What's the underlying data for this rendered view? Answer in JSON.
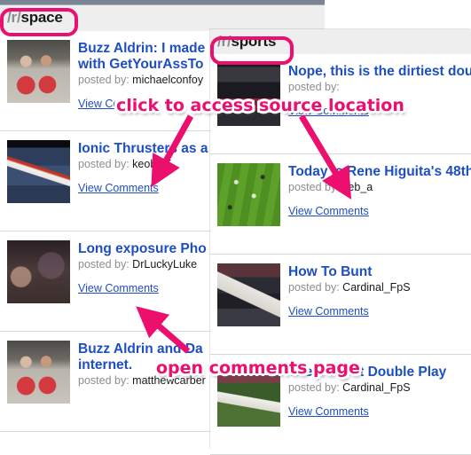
{
  "page": {
    "accent_highlight": "#ec0f6e",
    "link_color": "#1d4ec4",
    "header_bg": "#eeeeee"
  },
  "panels": [
    {
      "id": "space",
      "subreddit_prefix": "/r/",
      "subreddit_name": "space",
      "posts": [
        {
          "title": "Buzz Aldrin: I made",
          "title_line2": "with GetYourAssTo",
          "posted_label": "posted by:",
          "author": "michaelconfoy",
          "comments_label": "View Comments",
          "thumb": "art-aldrin"
        },
        {
          "title": "Ionic Thrusters as a",
          "title_line2": "",
          "posted_label": "posted by:",
          "author": "keobUK",
          "comments_label": "View Comments",
          "thumb": "art-plane"
        },
        {
          "title": "Long exposure Pho",
          "title_line2": "",
          "posted_label": "posted by:",
          "author": "DrLuckyLuke",
          "comments_label": "View Comments",
          "thumb": "art-night"
        },
        {
          "title": "Buzz Aldrin and Da",
          "title_line2": "internet.",
          "posted_label": "posted by:",
          "author": "matthewcarber",
          "comments_label": "View Comments",
          "thumb": "art-aldrin"
        }
      ]
    },
    {
      "id": "sports",
      "subreddit_prefix": "/r/",
      "subreddit_name": "sports",
      "posts": [
        {
          "title": "Nope, this is the dirtiest dou",
          "title_line2": "",
          "posted_label": "posted by:",
          "author": "",
          "comments_label": "View Comments",
          "thumb": "art-stage"
        },
        {
          "title": "Today is Rene Higuita's 48th",
          "title_line2": "",
          "posted_label": "posted by:",
          "author": "seb_a",
          "comments_label": "View Comments",
          "thumb": "art-pitch"
        },
        {
          "title": "How To Bunt",
          "title_line2": "",
          "posted_label": "posted by:",
          "author": "Cardinal_FpS",
          "comments_label": "View Comments",
          "thumb": "art-bunt"
        },
        {
          "title": "The Dirtiest Double Play",
          "title_line2": "",
          "posted_label": "posted by:",
          "author": "Cardinal_FpS",
          "comments_label": "View Comments",
          "thumb": "art-double"
        }
      ]
    }
  ],
  "annotations": [
    {
      "id": "source",
      "text": "click to access source location"
    },
    {
      "id": "comments",
      "text": "open comments page"
    }
  ]
}
